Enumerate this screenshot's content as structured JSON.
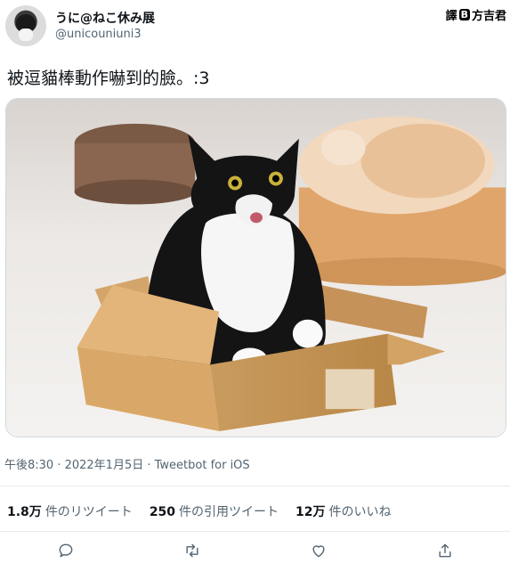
{
  "author": {
    "display_name": "うに@ねこ休み展",
    "handle": "@unicouniuni3"
  },
  "watermark": {
    "part1": "譯",
    "part2": "B",
    "part3": "方吉君"
  },
  "tweet": {
    "text": "被逗貓棒動作嚇到的臉。:3",
    "meta": "午後8:30 · 2022年1月5日 · Tweetbot for iOS"
  },
  "stats": [
    {
      "count": "1.8万",
      "label": "件のリツイート"
    },
    {
      "count": "250",
      "label": "件の引用ツイート"
    },
    {
      "count": "12万",
      "label": "件のいいね"
    }
  ],
  "actions": [
    {
      "icon": "reply-icon"
    },
    {
      "icon": "retweet-icon"
    },
    {
      "icon": "like-icon"
    },
    {
      "icon": "share-icon"
    }
  ]
}
